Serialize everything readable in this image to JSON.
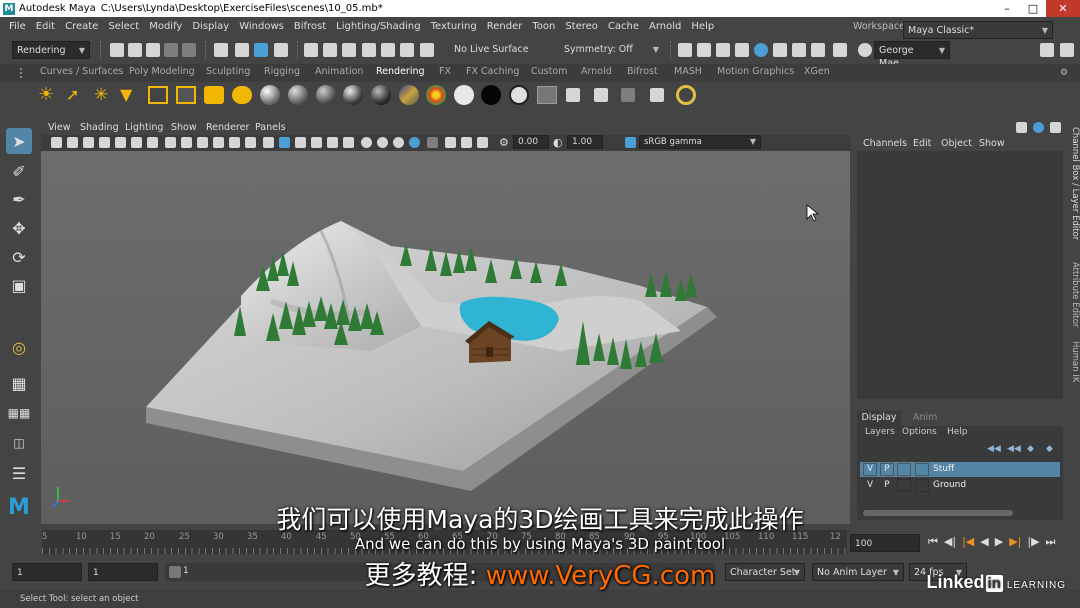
{
  "title_bar": {
    "app_title": "Autodesk Maya",
    "file_path": "C:\\Users\\Lynda\\Desktop\\ExerciseFiles\\scenes\\10_05.mb*"
  },
  "menu": [
    "File",
    "Edit",
    "Create",
    "Select",
    "Modify",
    "Display",
    "Windows",
    "Bifrost",
    "Lighting/Shading",
    "Texturing",
    "Render",
    "Toon",
    "Stereo",
    "Cache",
    "Arnold",
    "Help"
  ],
  "status_line": {
    "menu_set": "Rendering",
    "live_surface": "No Live Surface",
    "symmetry": "Symmetry: Off",
    "user": "George Mae...",
    "workspace_label": "Workspace :",
    "workspace_value": "Maya Classic*"
  },
  "shelf_tabs": [
    "Curves / Surfaces",
    "Poly Modeling",
    "Sculpting",
    "Rigging",
    "Animation",
    "Rendering",
    "FX",
    "FX Caching",
    "Custom",
    "Arnold",
    "Bifrost",
    "MASH",
    "Motion Graphics",
    "XGen"
  ],
  "shelf_active_tab": "Rendering",
  "viewport": {
    "menus": [
      "View",
      "Shading",
      "Lighting",
      "Show",
      "Renderer",
      "Panels"
    ],
    "exposure": "0.00",
    "gamma": "1.00",
    "color_space": "sRGB gamma"
  },
  "channel_box": {
    "menus": [
      "Channels",
      "Edit",
      "Object",
      "Show"
    ]
  },
  "side_tabs": [
    "Channel Box / Layer Editor",
    "Attribute Editor",
    "Human IK"
  ],
  "layer_editor": {
    "tabs": [
      "Display",
      "Anim"
    ],
    "menus": [
      "Layers",
      "Options",
      "Help"
    ],
    "layers": [
      {
        "v": "V",
        "p": "P",
        "name": "Stuff",
        "selected": true
      },
      {
        "v": "V",
        "p": "P",
        "name": "Ground",
        "selected": false
      }
    ]
  },
  "timeline": {
    "ticks": [
      "5",
      "10",
      "15",
      "20",
      "25",
      "30",
      "35",
      "40",
      "45",
      "50",
      "55",
      "60",
      "65",
      "70",
      "75",
      "80",
      "85",
      "90",
      "95",
      "100",
      "105",
      "110",
      "115",
      "12"
    ],
    "current_frame": "100",
    "start": "1",
    "start_inner": "1",
    "range_start": "1",
    "character_set": "Character Set",
    "anim_layer": "No Anim Layer",
    "fps": "24 fps"
  },
  "help_line": "Select Tool: select an object",
  "subtitles": {
    "chinese": "我们可以使用Maya的3D绘画工具来完成此操作",
    "english": "And we can do this by using Maya's 3D paint tool",
    "watermark_prefix": "更多教程:",
    "watermark_url": "www.VeryCG.com"
  },
  "logo": {
    "text": "Linked",
    "in": "in",
    "learning": "LEARNING"
  },
  "colors": {
    "selection": "#5285a6",
    "lake": "#2fb4d4",
    "cabin": "#6b4523",
    "trees": "#2f7a35",
    "watermark_url": "#ff6a00"
  }
}
